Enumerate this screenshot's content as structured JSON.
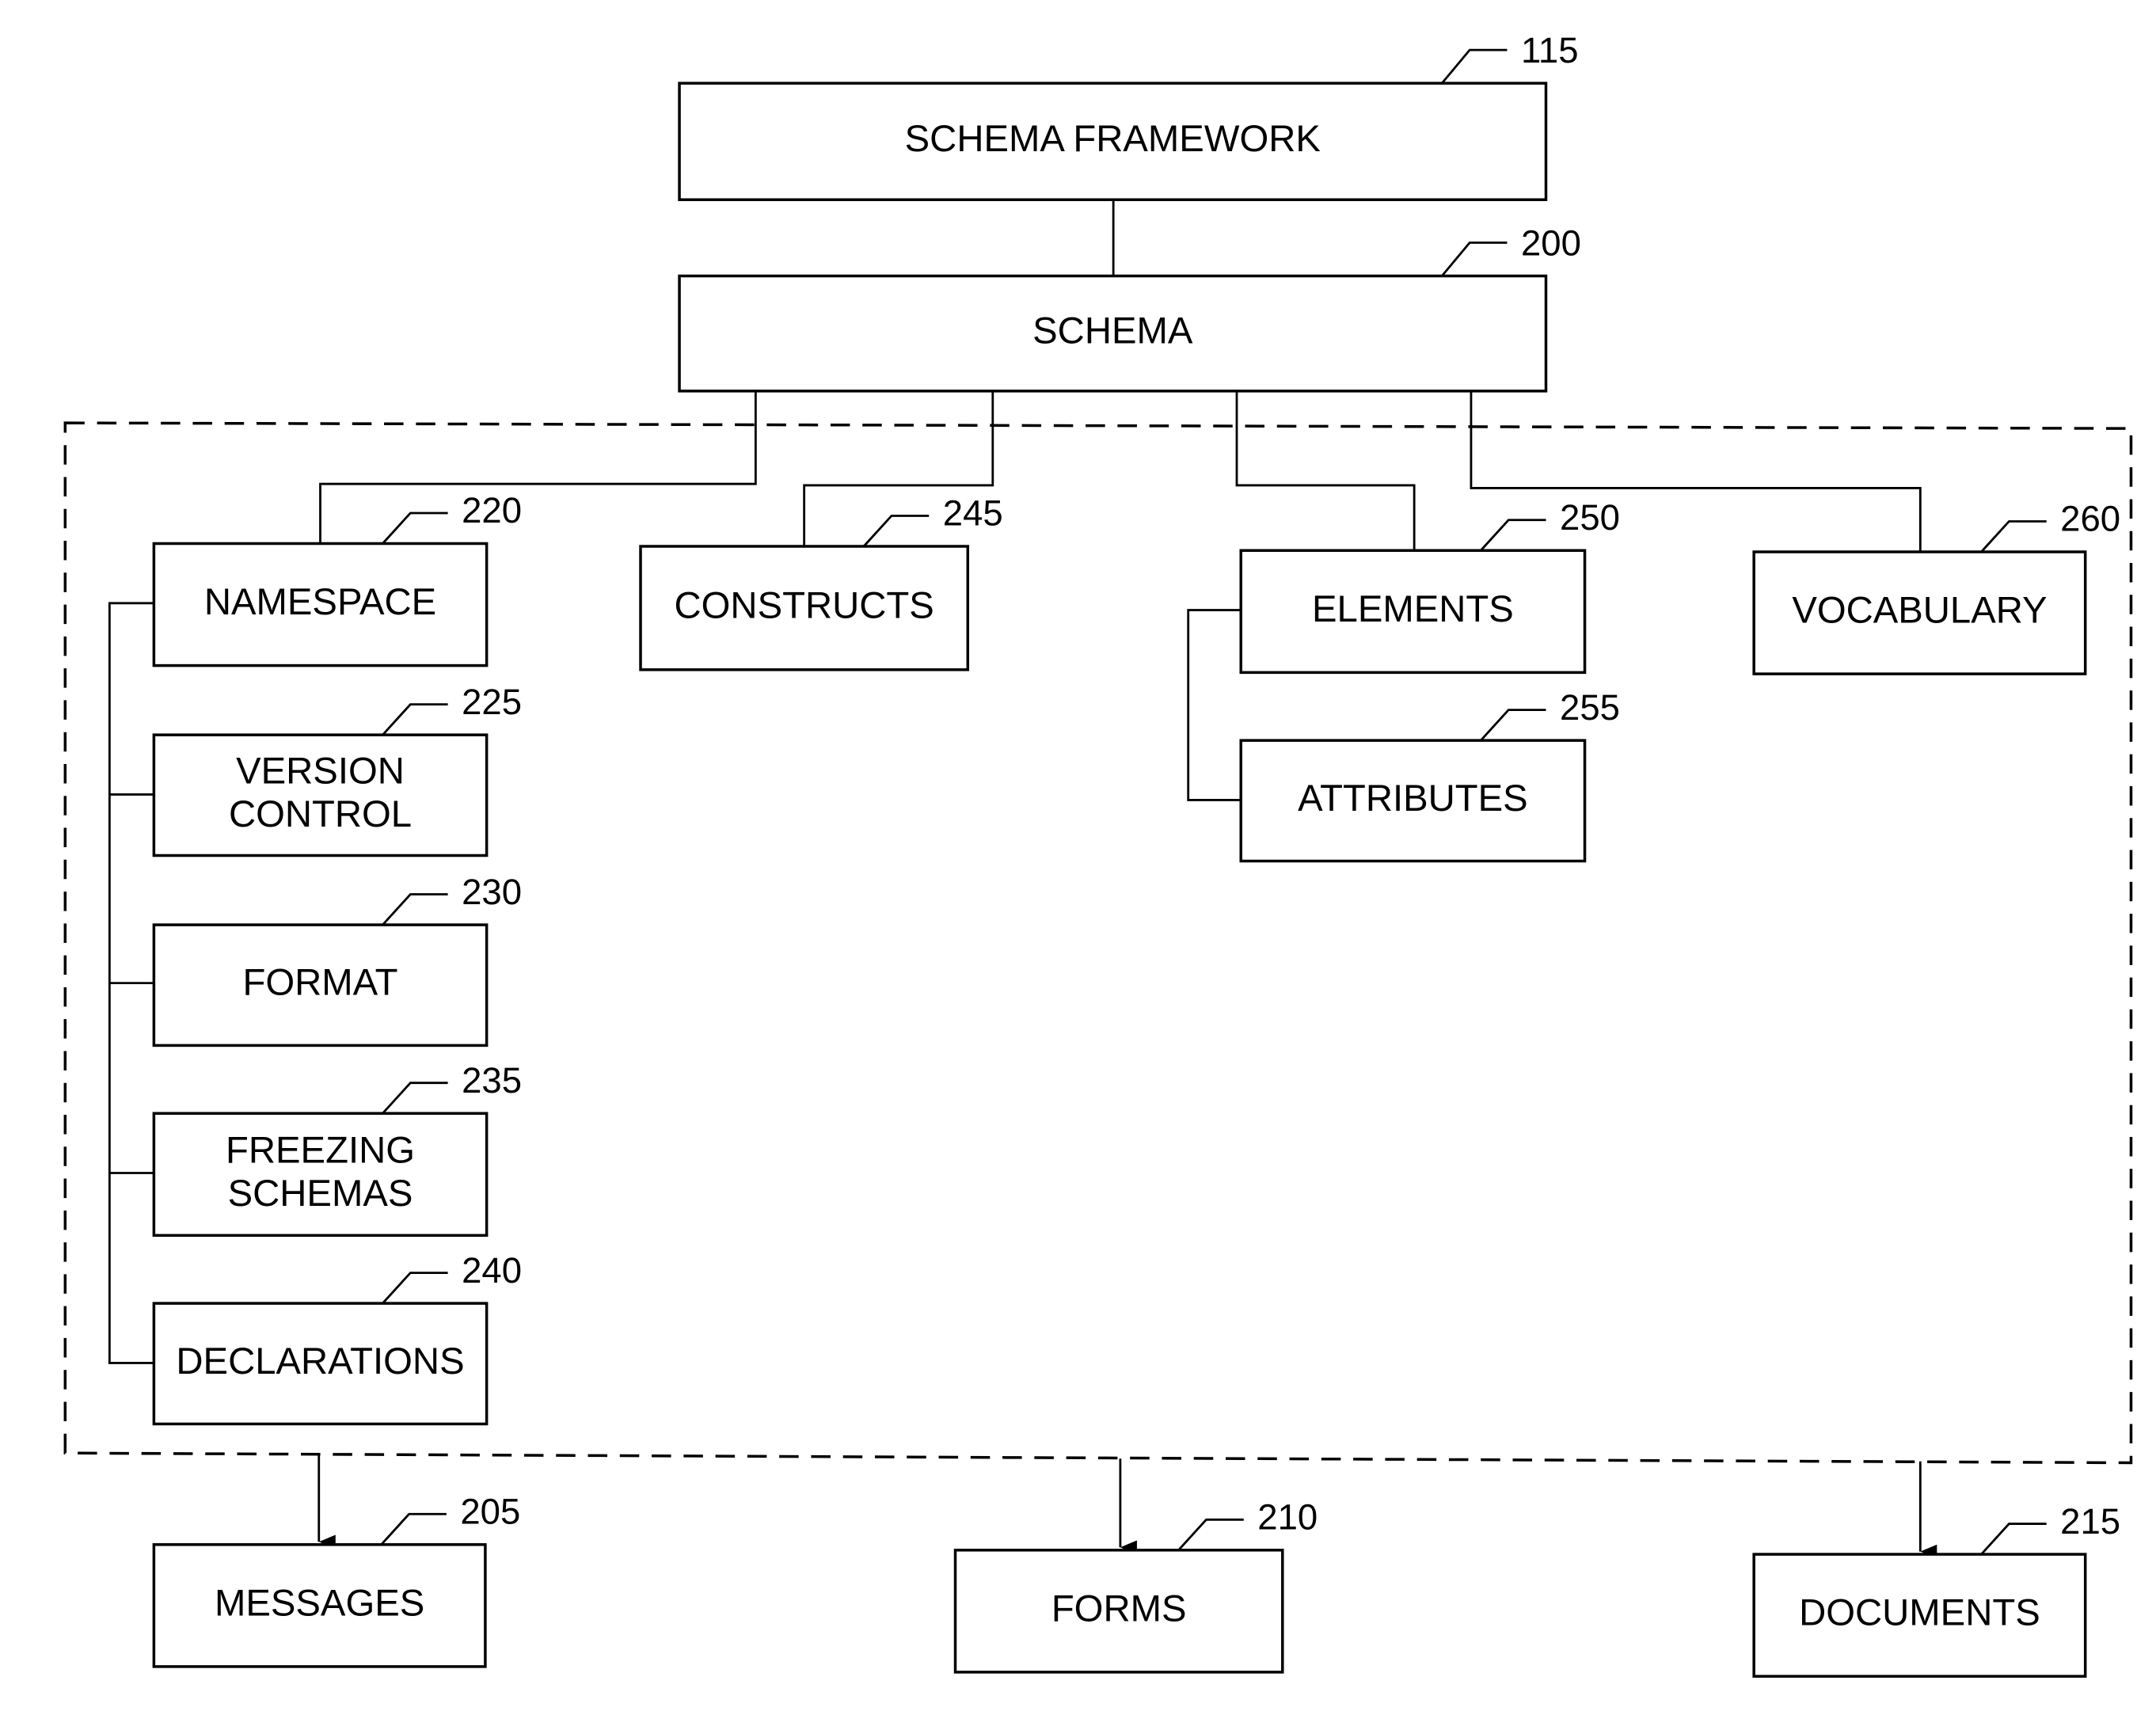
{
  "diagram": {
    "nodes": [
      {
        "id": "framework",
        "label": [
          "SCHEMA FRAMEWORK"
        ],
        "ref": "115"
      },
      {
        "id": "schema",
        "label": [
          "SCHEMA"
        ],
        "ref": "200"
      },
      {
        "id": "namespace",
        "label": [
          "NAMESPACE"
        ],
        "ref": "220"
      },
      {
        "id": "version-control",
        "label": [
          "VERSION",
          "CONTROL"
        ],
        "ref": "225"
      },
      {
        "id": "format",
        "label": [
          "FORMAT"
        ],
        "ref": "230"
      },
      {
        "id": "freezing-schemas",
        "label": [
          "FREEZING",
          "SCHEMAS"
        ],
        "ref": "235"
      },
      {
        "id": "declarations",
        "label": [
          "DECLARATIONS"
        ],
        "ref": "240"
      },
      {
        "id": "constructs",
        "label": [
          "CONSTRUCTS"
        ],
        "ref": "245"
      },
      {
        "id": "elements",
        "label": [
          "ELEMENTS"
        ],
        "ref": "250"
      },
      {
        "id": "attributes",
        "label": [
          "ATTRIBUTES"
        ],
        "ref": "255"
      },
      {
        "id": "vocabulary",
        "label": [
          "VOCABULARY"
        ],
        "ref": "260"
      },
      {
        "id": "messages",
        "label": [
          "MESSAGES"
        ],
        "ref": "205"
      },
      {
        "id": "forms",
        "label": [
          "FORMS"
        ],
        "ref": "210"
      },
      {
        "id": "documents",
        "label": [
          "DOCUMENTS"
        ],
        "ref": "215"
      }
    ],
    "edges": [
      [
        "framework",
        "schema"
      ],
      [
        "schema",
        "namespace"
      ],
      [
        "schema",
        "constructs"
      ],
      [
        "schema",
        "elements"
      ],
      [
        "schema",
        "vocabulary"
      ],
      [
        "namespace",
        "version-control"
      ],
      [
        "namespace",
        "format"
      ],
      [
        "namespace",
        "freezing-schemas"
      ],
      [
        "namespace",
        "declarations"
      ],
      [
        "elements",
        "attributes"
      ],
      [
        "schema-group",
        "messages"
      ],
      [
        "schema-group",
        "forms"
      ],
      [
        "schema-group",
        "documents"
      ]
    ]
  }
}
